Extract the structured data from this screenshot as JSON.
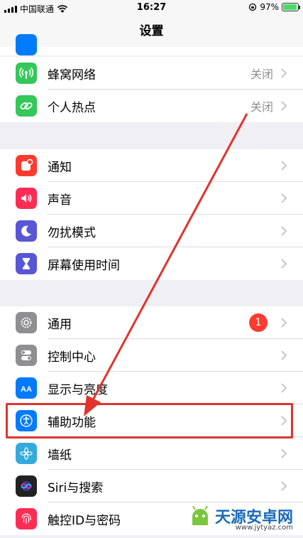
{
  "status_bar": {
    "carrier": "中国联通",
    "time": "16:27",
    "battery_pct": "97%"
  },
  "nav": {
    "title": "设置"
  },
  "group1": [
    {
      "name": "cellular",
      "label": "蜂窝网络",
      "value": "关闭",
      "icon": "antenna-icon",
      "color": "#34c759"
    },
    {
      "name": "hotspot",
      "label": "个人热点",
      "value": "关闭",
      "icon": "chain-link-icon",
      "color": "#34c759"
    }
  ],
  "group2": [
    {
      "name": "notifications",
      "label": "通知",
      "icon": "notification-icon",
      "color": "#ff3b30"
    },
    {
      "name": "sounds",
      "label": "声音",
      "icon": "speaker-icon",
      "color": "#ff2d55"
    },
    {
      "name": "do-not-disturb",
      "label": "勿扰模式",
      "icon": "moon-icon",
      "color": "#5856d6"
    },
    {
      "name": "screen-time",
      "label": "屏幕使用时间",
      "icon": "hourglass-icon",
      "color": "#5856d6"
    }
  ],
  "group3": [
    {
      "name": "general",
      "label": "通用",
      "badge": "1",
      "icon": "gear-icon",
      "color": "#8e8e93"
    },
    {
      "name": "control-center",
      "label": "控制中心",
      "icon": "toggles-icon",
      "color": "#8e8e93"
    },
    {
      "name": "display",
      "label": "显示与亮度",
      "icon": "text-size-icon",
      "color": "#007aff"
    },
    {
      "name": "accessibility",
      "label": "辅助功能",
      "icon": "accessibility-icon",
      "color": "#007aff"
    },
    {
      "name": "wallpaper",
      "label": "墙纸",
      "icon": "flower-icon",
      "color": "#34aadc"
    },
    {
      "name": "siri",
      "label": "Siri与搜索",
      "icon": "siri-icon",
      "color": "#222222"
    },
    {
      "name": "touch-id",
      "label": "触控ID与密码",
      "icon": "fingerprint-icon",
      "color": "#ff2d55"
    }
  ],
  "watermark": {
    "text": "天源安卓网",
    "url": "www.jytyaz.com"
  }
}
